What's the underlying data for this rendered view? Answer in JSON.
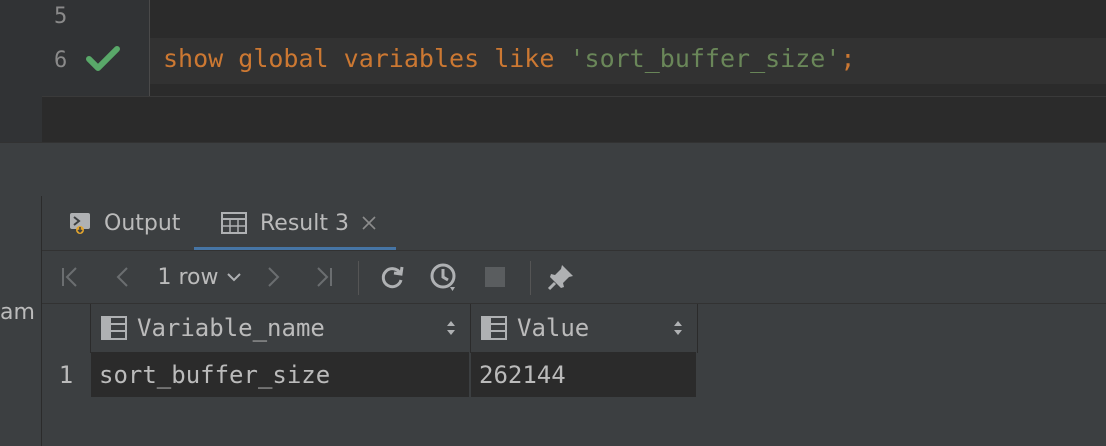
{
  "editor": {
    "lines": [
      {
        "number": "5"
      },
      {
        "number": "6"
      }
    ],
    "code": {
      "kw_show": "show",
      "kw_global": "global",
      "kw_variables": "variables",
      "kw_like": "like",
      "string": "'sort_buffer_size'",
      "terminator": ";"
    },
    "check_color": "#59a869"
  },
  "side": {
    "label": "am"
  },
  "tabs": [
    {
      "label": "Output",
      "icon": "output-console-icon"
    },
    {
      "label": "Result 3",
      "icon": "table-grid-icon",
      "closable": true
    }
  ],
  "toolbar": {
    "row_count": "1 row",
    "buttons": [
      "first-page-icon",
      "prev-page-icon",
      "next-page-icon",
      "last-page-icon",
      "reload-icon",
      "history-clock-icon",
      "stop-icon",
      "pin-icon"
    ]
  },
  "grid": {
    "columns": [
      {
        "name": "Variable_name"
      },
      {
        "name": "Value"
      }
    ],
    "rows": [
      {
        "index": "1",
        "cells": [
          "sort_buffer_size",
          "262144"
        ]
      }
    ]
  }
}
